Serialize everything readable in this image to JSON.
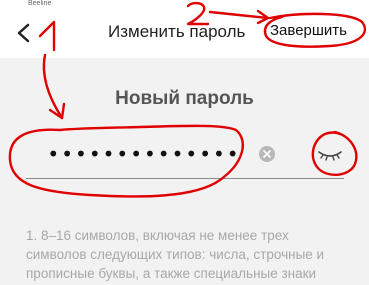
{
  "status_bar": {
    "text": "Beeline"
  },
  "header": {
    "title": "Изменить пароль",
    "finish_label": "Завершить",
    "back_icon": "back-chevron-icon"
  },
  "form": {
    "heading": "Новый пароль",
    "password_value": "••••••••••••••",
    "clear_icon": "clear-icon",
    "visibility_icon": "eye-closed-icon"
  },
  "hint": {
    "text": "1. 8–16 символов, включая не менее трех символов следующих типов: числа, строчные и прописные буквы, а также специальные знаки"
  },
  "annotations": {
    "marker_color": "#e00000",
    "number_one": "1",
    "number_two": "2"
  }
}
